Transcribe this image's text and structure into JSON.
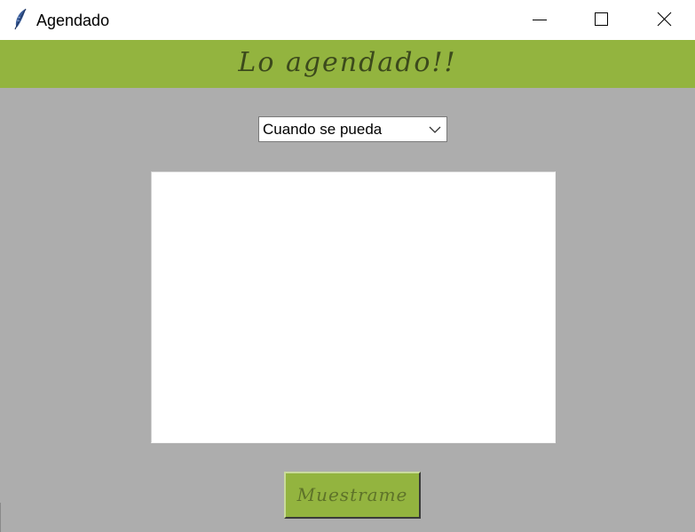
{
  "window": {
    "title": "Agendado",
    "app_icon": "feather-icon",
    "controls": [
      "minimize-icon",
      "maximize-icon",
      "close-icon"
    ]
  },
  "header": {
    "text": "Lo agendado!!",
    "background": "#93b43f"
  },
  "dropdown": {
    "selected": "Cuando se pueda",
    "icon": "chevron-down-icon"
  },
  "text_area": {
    "value": ""
  },
  "button": {
    "label": "Muestrame",
    "background": "#93b43f"
  },
  "colors": {
    "window_background": "#adadad",
    "accent": "#93b43f",
    "header_text": "#3c4a1c"
  }
}
